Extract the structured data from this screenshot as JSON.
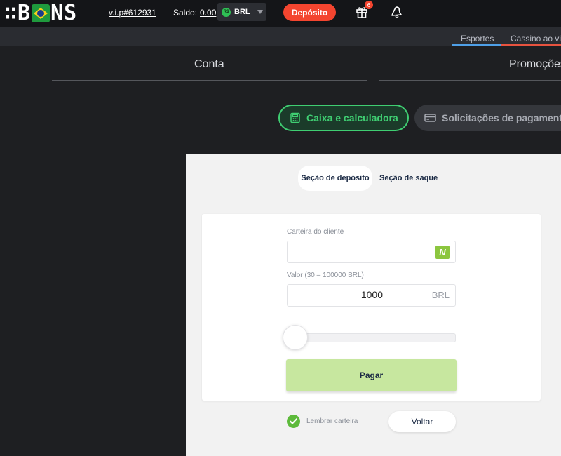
{
  "header": {
    "logo_left": "∷B",
    "logo_right": "NS",
    "vip": "v.i.p#612931",
    "saldo_label": "Saldo:",
    "saldo_value": "0.00",
    "currency_icon": "R$",
    "currency": "BRL",
    "deposit": "Depósito",
    "gift_badge": "6"
  },
  "subnav": {
    "items": [
      "Esportes",
      "Cassino ao vivo"
    ]
  },
  "account_tabs": [
    "Conta",
    "Promoções"
  ],
  "pills": {
    "active": "Caixa e calculadora",
    "inactive": "Solicitações de pagamento"
  },
  "section_tabs": {
    "deposit": "Seção de depósito",
    "withdraw": "Seção de saque"
  },
  "form": {
    "wallet_label": "Carteira do cliente",
    "wallet_value": "",
    "wallet_brand": "N",
    "amount_label": "Valor (30 – 100000 BRL)",
    "amount_value": "1000",
    "amount_currency": "BRL",
    "pay": "Pagar"
  },
  "remember": "Lembrar carteira",
  "back": "Voltar",
  "colors": {
    "accent_green": "#3fce72",
    "deposit_red": "#f4452f",
    "pay_green": "#c7e79f"
  }
}
